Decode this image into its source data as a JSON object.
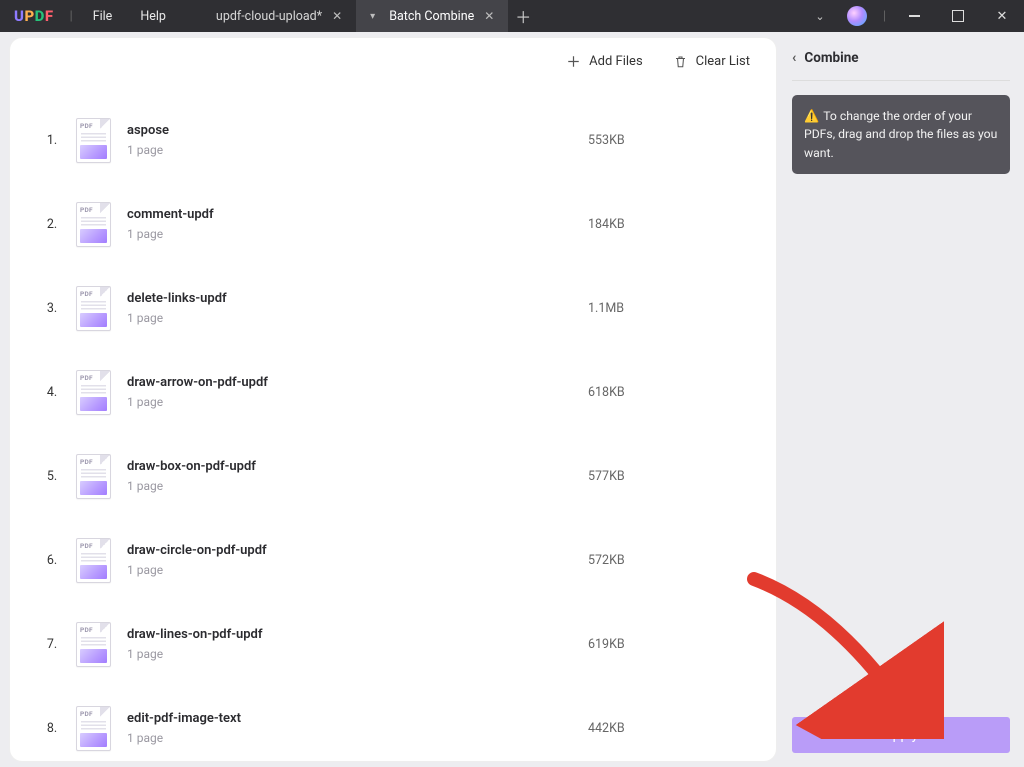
{
  "menu": {
    "file": "File",
    "help": "Help"
  },
  "tabs": {
    "t1": "updf-cloud-upload*",
    "t2": "Batch Combine"
  },
  "toolbar": {
    "addFiles": "Add Files",
    "clearList": "Clear List"
  },
  "files": [
    {
      "index": "1.",
      "name": "aspose",
      "pages": "1 page",
      "size": "553KB"
    },
    {
      "index": "2.",
      "name": "comment-updf",
      "pages": "1 page",
      "size": "184KB"
    },
    {
      "index": "3.",
      "name": "delete-links-updf",
      "pages": "1 page",
      "size": "1.1MB"
    },
    {
      "index": "4.",
      "name": "draw-arrow-on-pdf-updf",
      "pages": "1 page",
      "size": "618KB"
    },
    {
      "index": "5.",
      "name": "draw-box-on-pdf-updf",
      "pages": "1 page",
      "size": "577KB"
    },
    {
      "index": "6.",
      "name": "draw-circle-on-pdf-updf",
      "pages": "1 page",
      "size": "572KB"
    },
    {
      "index": "7.",
      "name": "draw-lines-on-pdf-updf",
      "pages": "1 page",
      "size": "619KB"
    },
    {
      "index": "8.",
      "name": "edit-pdf-image-text",
      "pages": "1 page",
      "size": "442KB"
    }
  ],
  "side": {
    "title": "Combine",
    "tip": "To change the order of your PDFs, drag and drop the files as you want.",
    "apply": "Apply"
  }
}
